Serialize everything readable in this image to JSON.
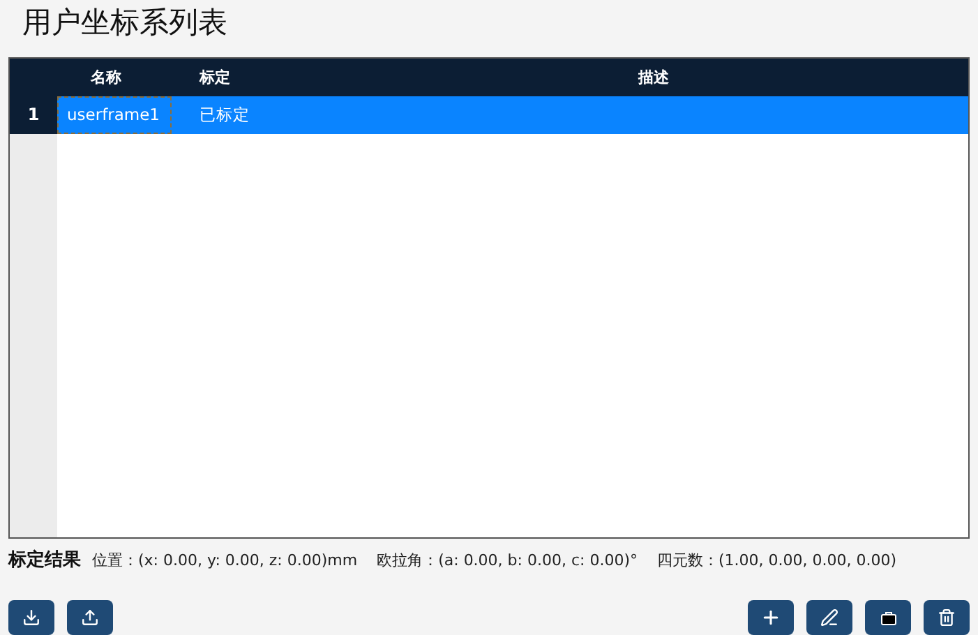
{
  "title": "用户坐标系列表",
  "table": {
    "columns": [
      "名称",
      "标定",
      "描述"
    ],
    "rows": [
      {
        "index": "1",
        "name": "userframe1",
        "calibration": "已标定",
        "description": "",
        "selected": true
      }
    ]
  },
  "result": {
    "label": "标定结果",
    "items": [
      {
        "label": "位置：",
        "value": "(x: 0.00, y: 0.00, z: 0.00)mm"
      },
      {
        "label": "欧拉角：",
        "value": "(a: 0.00, b: 0.00, c: 0.00)°"
      },
      {
        "label": "四元数：",
        "value": "(1.00, 0.00, 0.00, 0.00)"
      }
    ]
  },
  "left_buttons": [
    {
      "kind": "import"
    },
    {
      "kind": "export"
    }
  ],
  "right_buttons": [
    {
      "kind": "add"
    },
    {
      "kind": "edit"
    },
    {
      "kind": "box"
    },
    {
      "kind": "delete"
    }
  ]
}
